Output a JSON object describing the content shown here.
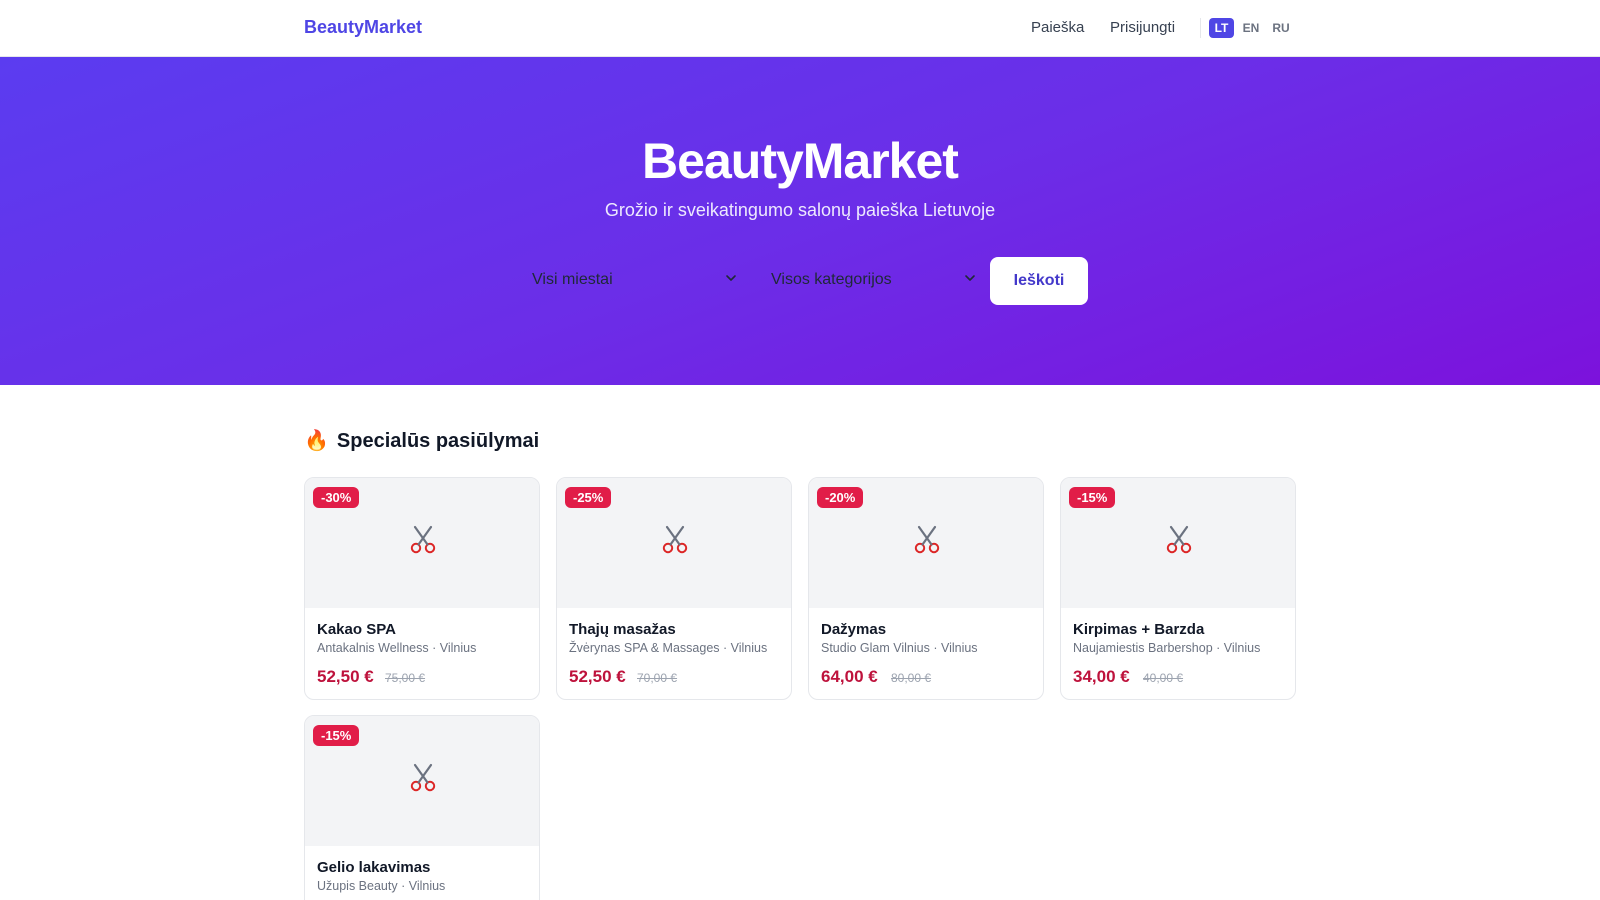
{
  "header": {
    "logo": "BeautyMarket",
    "nav": {
      "search": "Paieška",
      "login": "Prisijungti"
    },
    "languages": [
      "LT",
      "EN",
      "RU"
    ],
    "active_language": "LT"
  },
  "hero": {
    "title": "BeautyMarket",
    "subtitle": "Grožio ir sveikatingumo salonų paieška Lietuvoje",
    "city_select": "Visi miestai",
    "category_select": "Visos kategorijos",
    "search_button": "Ieškoti"
  },
  "offers": {
    "title": "Specialūs pasiūlymai",
    "icon": "fire-icon",
    "items": [
      {
        "discount": "-30%",
        "name": "Kakao SPA",
        "salon": "Antakalnis Wellness · Vilnius",
        "price": "52,50 €",
        "old_price": "75,00 €",
        "icon": "scissors-icon"
      },
      {
        "discount": "-25%",
        "name": "Thajų masažas",
        "salon": "Žvėrynas SPA & Massages · Vilnius",
        "price": "52,50 €",
        "old_price": "70,00 €",
        "icon": "scissors-icon"
      },
      {
        "discount": "-20%",
        "name": "Dažymas",
        "salon": "Studio Glam Vilnius · Vilnius",
        "price": "64,00 €",
        "old_price": "80,00 €",
        "icon": "scissors-icon"
      },
      {
        "discount": "-15%",
        "name": "Kirpimas + Barzda",
        "salon": "Naujamiestis Barbershop · Vilnius",
        "price": "34,00 €",
        "old_price": "40,00 €",
        "icon": "scissors-icon"
      },
      {
        "discount": "-15%",
        "name": "Gelio lakavimas",
        "salon": "Užupis Beauty · Vilnius",
        "icon": "scissors-icon"
      }
    ]
  },
  "colors": {
    "brand": "#4f46e5",
    "hero_gradient_start": "#5b3cf0",
    "hero_gradient_end": "#7c12dc",
    "discount_badge": "#e11d48",
    "price": "#be123c"
  }
}
